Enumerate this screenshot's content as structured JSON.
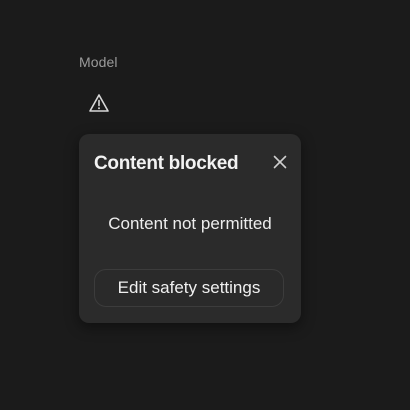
{
  "header": {
    "label": "Model"
  },
  "status": {
    "icon": "warning-triangle-icon"
  },
  "popup": {
    "title": "Content blocked",
    "close_icon": "close-icon",
    "message": "Content not permitted",
    "action_label": "Edit safety settings"
  },
  "colors": {
    "background": "#1b1b1b",
    "popup_background": "#2b2b2b",
    "button_border": "#3c3c3c",
    "text_primary": "#f2f2f2",
    "text_muted": "#9b9b9b"
  }
}
